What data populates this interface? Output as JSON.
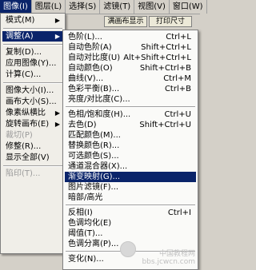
{
  "menubar": [
    {
      "label": "图像(I)",
      "active": true
    },
    {
      "label": "图层(L)"
    },
    {
      "label": "选择(S)"
    },
    {
      "label": "滤镜(T)"
    },
    {
      "label": "视图(V)"
    },
    {
      "label": "窗口(W)"
    }
  ],
  "toolbar": {
    "fit_screen": "满画布显示",
    "print_size": "打印尺寸"
  },
  "left_menu": [
    {
      "label": "模式(M)",
      "arrow": true
    },
    {
      "sep": true
    },
    {
      "label": "调整(A)",
      "arrow": true,
      "hl": true
    },
    {
      "sep": true
    },
    {
      "label": "复制(D)..."
    },
    {
      "label": "应用图像(Y)..."
    },
    {
      "label": "计算(C)..."
    },
    {
      "sep": true
    },
    {
      "label": "图像大小(I)..."
    },
    {
      "label": "画布大小(S)..."
    },
    {
      "label": "像素纵横比",
      "arrow": true
    },
    {
      "label": "旋转画布(E)",
      "arrow": true
    },
    {
      "label": "裁切(P)",
      "dis": true
    },
    {
      "label": "修整(R)..."
    },
    {
      "label": "显示全部(V)"
    },
    {
      "sep": true
    },
    {
      "label": "陷印(T)...",
      "dis": true
    }
  ],
  "sub_menu": [
    {
      "label": "色阶(L)...",
      "sc": "Ctrl+L"
    },
    {
      "label": "自动色阶(A)",
      "sc": "Shift+Ctrl+L"
    },
    {
      "label": "自动对比度(U)",
      "sc": "Alt+Shift+Ctrl+L"
    },
    {
      "label": "自动颜色(O)",
      "sc": "Shift+Ctrl+B"
    },
    {
      "label": "曲线(V)...",
      "sc": "Ctrl+M"
    },
    {
      "label": "色彩平衡(B)...",
      "sc": "Ctrl+B"
    },
    {
      "label": "亮度/对比度(C)..."
    },
    {
      "sep": true
    },
    {
      "label": "色相/饱和度(H)...",
      "sc": "Ctrl+U"
    },
    {
      "label": "去色(D)",
      "sc": "Shift+Ctrl+U"
    },
    {
      "label": "匹配颜色(M)..."
    },
    {
      "label": "替换颜色(R)..."
    },
    {
      "label": "可选颜色(S)..."
    },
    {
      "label": "通道混合器(X)..."
    },
    {
      "label": "渐变映射(G)...",
      "hl": true
    },
    {
      "label": "图片滤镜(F)..."
    },
    {
      "label": "暗部/高光"
    },
    {
      "sep": true
    },
    {
      "label": "反相(I)",
      "sc": "Ctrl+I"
    },
    {
      "label": "色调均化(E)"
    },
    {
      "label": "阈值(T)..."
    },
    {
      "label": "色调分离(P)..."
    },
    {
      "sep": true
    },
    {
      "label": "变化(N)..."
    }
  ],
  "watermark": {
    "line1": "中国教程网",
    "line2": "bbs.jcwcn.com"
  }
}
